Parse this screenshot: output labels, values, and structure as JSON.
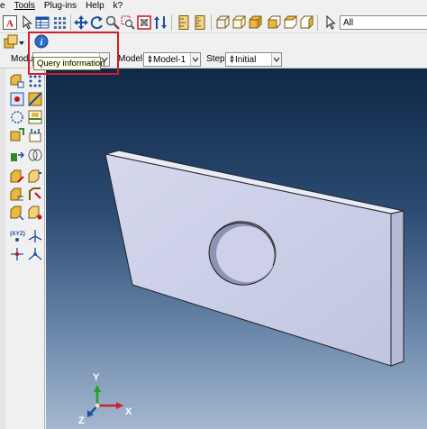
{
  "menubar": {
    "items": [
      "e",
      "Tools",
      "Plug-ins",
      "Help",
      "k?"
    ]
  },
  "toolbar": {
    "selection_filter": "All",
    "query_button_icon": "info-icon"
  },
  "tooltip": {
    "text": "Query information"
  },
  "context": {
    "module_label": "Modul",
    "model_label": "Model:",
    "model_value": "Model-1",
    "step_label": "Step:",
    "step_value": "Initial"
  },
  "triad": {
    "x_label": "X",
    "y_label": "Y",
    "z_label": "Z"
  },
  "toolbox": {
    "datum_label": "(XYZ)"
  },
  "colors": {
    "viewport_top": "#0f2847",
    "viewport_bottom": "#a4b8cf",
    "part_face": "#c9cce6",
    "highlight": "#d01f2a",
    "tooltip_bg": "#ffffe1"
  }
}
